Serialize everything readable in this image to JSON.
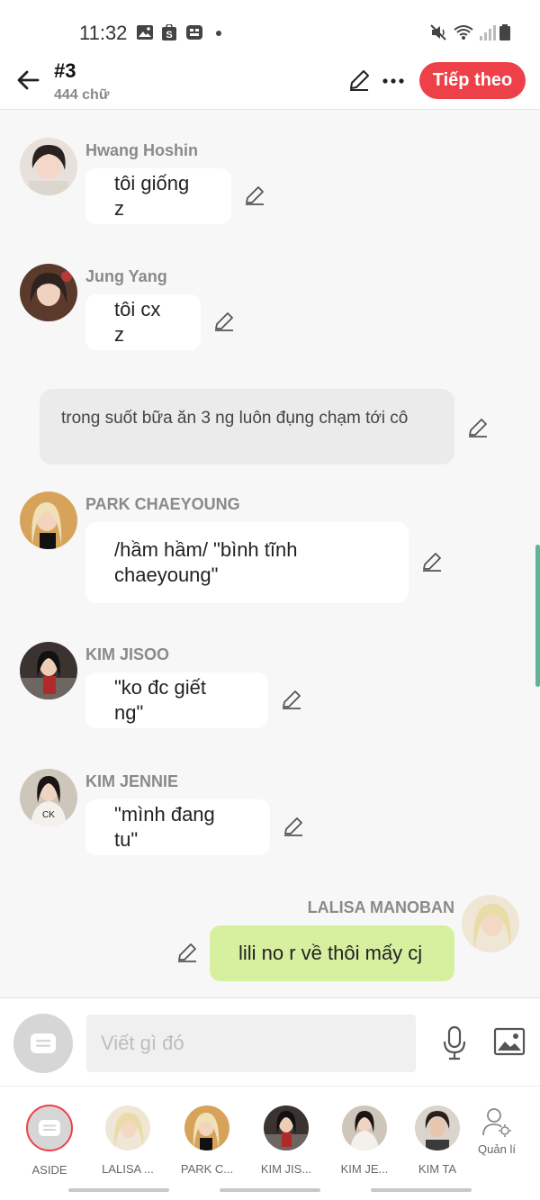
{
  "status_bar": {
    "time": "11:32"
  },
  "header": {
    "chapter_title": "#3",
    "word_count": "444 chữ",
    "next_label": "Tiếp theo"
  },
  "messages": [
    {
      "sender": "Hwang Hoshin",
      "text": "tôi giống z"
    },
    {
      "sender": "Jung Yang",
      "text": "tôi cx z"
    },
    {
      "narration": "trong suốt bữa ăn 3 ng luôn đụng chạm tới cô"
    },
    {
      "sender": "PARK CHAEYOUNG",
      "text": "/hầm hầm/ \"bình tĩnh chaeyoung\""
    },
    {
      "sender": "KIM JISOO",
      "text": "\"ko đc giết ng\""
    },
    {
      "sender": "KIM JENNIE",
      "text": "\"mình đang tu\""
    },
    {
      "sender": "LALISA MANOBAN",
      "text": "lili no r về thôi mấy cj"
    }
  ],
  "composer": {
    "placeholder": "Viết gì đó"
  },
  "characters": [
    {
      "name": "ASIDE"
    },
    {
      "name": "LALISA ..."
    },
    {
      "name": "PARK C..."
    },
    {
      "name": "KIM JIS..."
    },
    {
      "name": "KIM JE..."
    },
    {
      "name": "KIM TA"
    },
    {
      "name": "Quản lí"
    }
  ],
  "colors": {
    "accent": "#ee4048",
    "own_bubble": "#d6f0a0",
    "scroll": "#5fb39b"
  }
}
